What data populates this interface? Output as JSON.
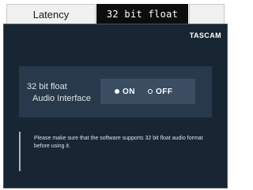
{
  "tabs": [
    {
      "label": "Latency",
      "active": false
    },
    {
      "label": "32 bit float",
      "active": true
    },
    {
      "label": "",
      "active": false
    }
  ],
  "brand": {
    "logo": "TASCAM"
  },
  "setting": {
    "label_line1": "32 bit float",
    "label_line2": "Audio Interface",
    "options": [
      {
        "label": "ON",
        "selected": true
      },
      {
        "label": "OFF",
        "selected": false
      }
    ]
  },
  "note": {
    "text": "Please make sure that the software supports 32 bit float audio format before using it."
  },
  "colors": {
    "panel_bg": "#182633",
    "settings_bg": "#27394b",
    "radio_bg": "#3a4d61",
    "active_tab_bg": "#0d0d0d",
    "inactive_tab_bg": "#f0f0f0"
  }
}
